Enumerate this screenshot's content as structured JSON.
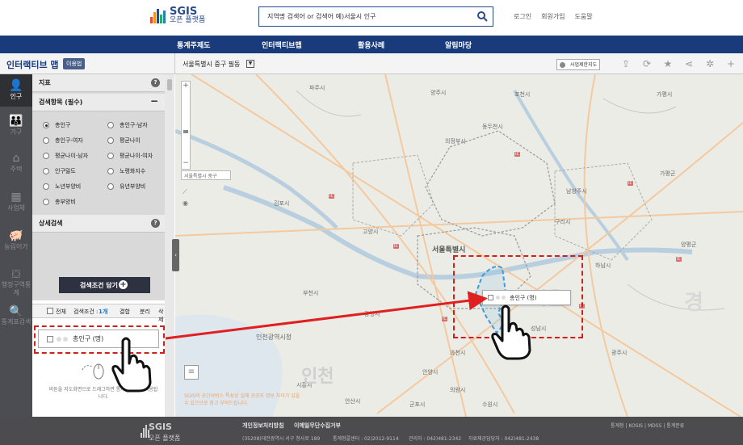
{
  "header": {
    "brand": "SGIS",
    "brand_sub": "오픈 플랫폼",
    "search_placeholder": "지역명 검색어 or 검색어 예)서울시 인구",
    "links": [
      "로그인",
      "회원가입",
      "도움말"
    ]
  },
  "nav": [
    "통계주제도",
    "인터랙티브맵",
    "활용사례",
    "알림마당"
  ],
  "subheader": {
    "title": "인터랙티브 맵",
    "badge": "이용법",
    "location": "서울특별시 중구 필동",
    "boundary_button": "사업제한지도"
  },
  "sidebar": {
    "items": [
      {
        "label": "인구",
        "icon": "person-icon"
      },
      {
        "label": "가구",
        "icon": "family-icon"
      },
      {
        "label": "주택",
        "icon": "house-icon"
      },
      {
        "label": "사업체",
        "icon": "building-icon"
      },
      {
        "label": "농림어가",
        "icon": "farm-icon"
      },
      {
        "label": "행정구역통계",
        "icon": "map-icon"
      },
      {
        "label": "통계표검색",
        "icon": "search-icon"
      }
    ]
  },
  "panel": {
    "indicator_heading": "지표",
    "search_items_heading": "검색항목 (필수)",
    "options": [
      "총인구",
      "총인구-남자",
      "총인구-여자",
      "평균나이",
      "평균나이-남자",
      "평균나이-여자",
      "인구밀도",
      "노령화지수",
      "노년부양비",
      "유년부양비",
      "총부양비"
    ],
    "selected_option": "총인구",
    "detail_heading": "상세검색",
    "add_button": "검색조건 담기",
    "list_bar": {
      "all": "전체",
      "count_label": "검색조건 :",
      "count": "1개",
      "actions": [
        "결합",
        "분리",
        "삭제"
      ]
    },
    "list_item": "총인구 (명)",
    "hint": "버튼을 지도화면으로 드래그하면 통계데이터가 적용됩니다."
  },
  "map": {
    "location_tag": "서울특별시 중구",
    "popup_item": "총인구 (명)",
    "notice": "SGIS의 공간서비스 특성상 실제 공공지 정보 차이가 있을 수 있으므로 참고 부탁드립니다.",
    "labels": [
      "파주시",
      "양주시",
      "포천시",
      "의정부시",
      "동두천시",
      "고양시",
      "김포시",
      "남양주시",
      "구리시",
      "서울특별시",
      "부천시",
      "인천광역시청",
      "광명시",
      "하남시",
      "가평군",
      "양평군",
      "성남시",
      "광주시",
      "안양시",
      "과천시",
      "시흥시",
      "안산시",
      "군포시",
      "수원시",
      "의왕시",
      "가평시",
      "서울",
      "인천"
    ]
  },
  "footer": {
    "brand": "SGIS",
    "brand_sub": "오픈 플랫폼",
    "privacy": "개인정보처리방침",
    "email_refusal": "이메일무단수집거부",
    "address": "(35208)대전광역시 서구 청사로 189",
    "contact1": "통계청콜센터 : 02)2012-9114",
    "contact2": "관리자 : 042)481-2342",
    "contact3": "자료제공담당자 : 042)481-2438",
    "sites": "통계청 | KOSIS | MDSS | 통계분류"
  }
}
